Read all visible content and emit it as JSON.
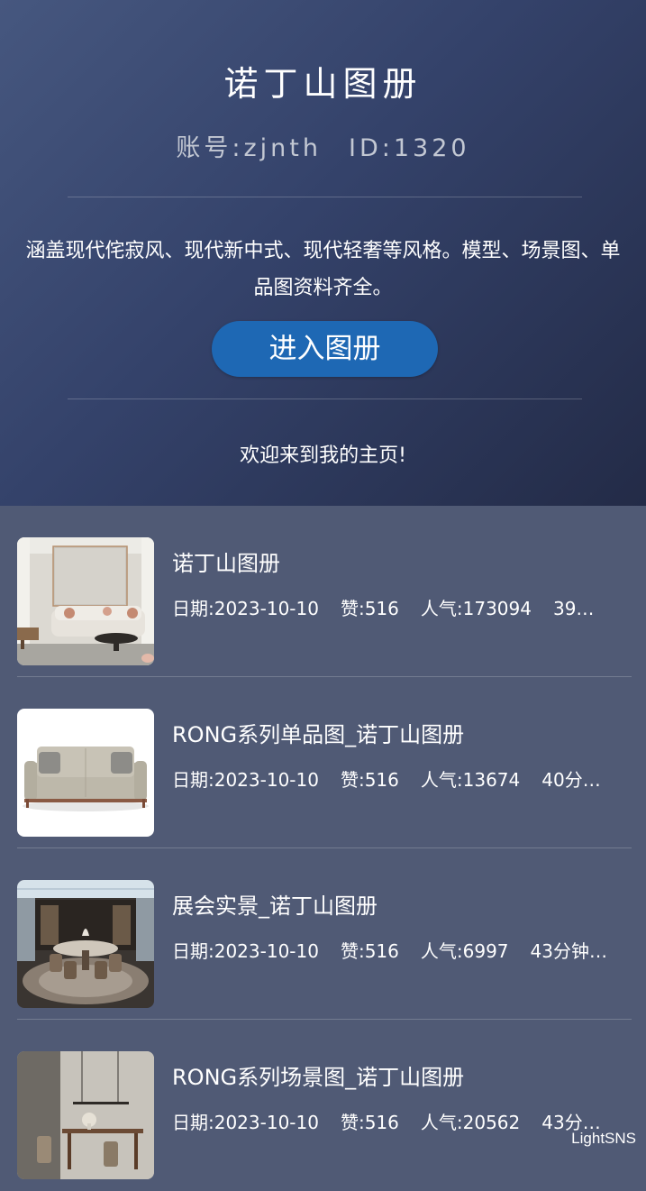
{
  "header": {
    "title": "诺丁山图册",
    "account_label": "账号:zjnth",
    "id_label": "ID:1320",
    "description": "涵盖现代侘寂风、现代新中式、现代轻奢等风格。模型、场景图、单品图资料齐全。",
    "enter_button": "进入图册",
    "welcome": "欢迎来到我的主页!"
  },
  "items": [
    {
      "title": "诺丁山图册",
      "date": "日期:2023-10-10",
      "likes": "赞:516",
      "popularity": "人气:173094",
      "time": "39…"
    },
    {
      "title": "RONG系列单品图_诺丁山图册",
      "date": "日期:2023-10-10",
      "likes": "赞:516",
      "popularity": "人气:13674",
      "time": "40分…"
    },
    {
      "title": "展会实景_诺丁山图册",
      "date": "日期:2023-10-10",
      "likes": "赞:516",
      "popularity": "人气:6997",
      "time": "43分钟…"
    },
    {
      "title": "RONG系列场景图_诺丁山图册",
      "date": "日期:2023-10-10",
      "likes": "赞:516",
      "popularity": "人气:20562",
      "time": "43分…"
    }
  ],
  "watermark": "LightSNS",
  "colors": {
    "header_start": "#46577f",
    "header_end": "#232b47",
    "list_background": "#505a75",
    "button": "#1e68b4"
  }
}
